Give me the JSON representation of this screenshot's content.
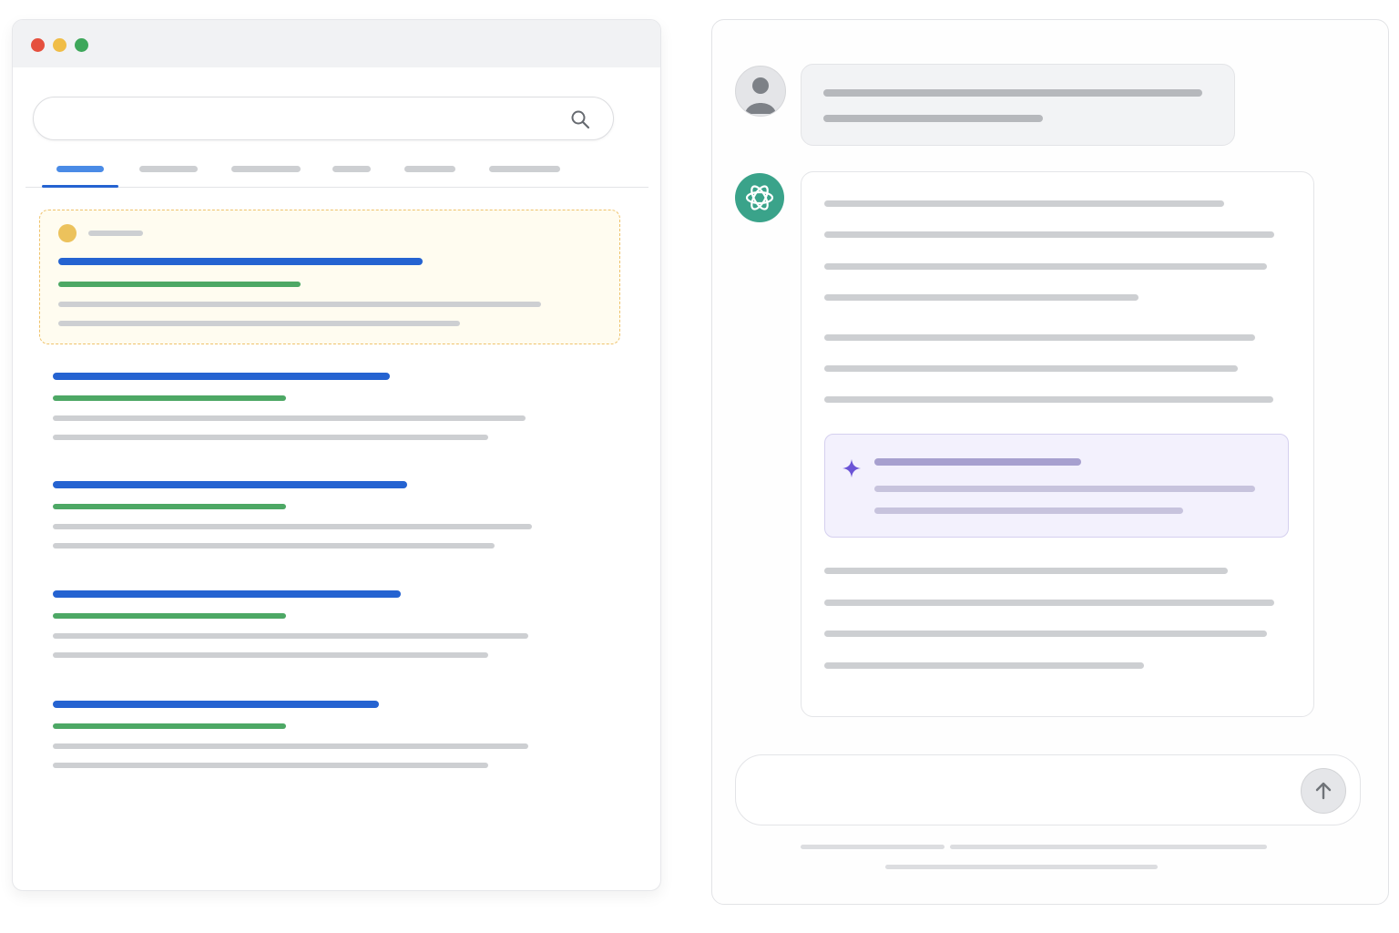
{
  "colors": {
    "close_dot": "#e5503e",
    "minimize_dot": "#f0bd47",
    "maximize_dot": "#3ea75b",
    "result_title_blue": "#2563d1",
    "result_url_green": "#4da865",
    "placeholder_grey": "#cdcfd2",
    "featured_border": "#efc26b",
    "featured_bg": "#fffcf0",
    "assistant_logo_bg": "#3aa38a",
    "insight_accent": "#6b54d6",
    "insight_bg": "#f3f1fd"
  },
  "icons": {
    "search": "search-icon",
    "user_avatar": "user-avatar-icon",
    "assistant_logo": "assistant-logo-icon",
    "sparkle": "sparkle-icon",
    "send": "arrow-up-icon"
  },
  "browser": {
    "active_tab_index": 0,
    "tab_count": 6,
    "featured_result": {
      "highlighted": true
    },
    "result_count": 4
  },
  "chat": {
    "user_message_lines": 2,
    "answer_paragraph_lines": [
      4,
      3,
      4
    ],
    "insight_lines": 3
  }
}
